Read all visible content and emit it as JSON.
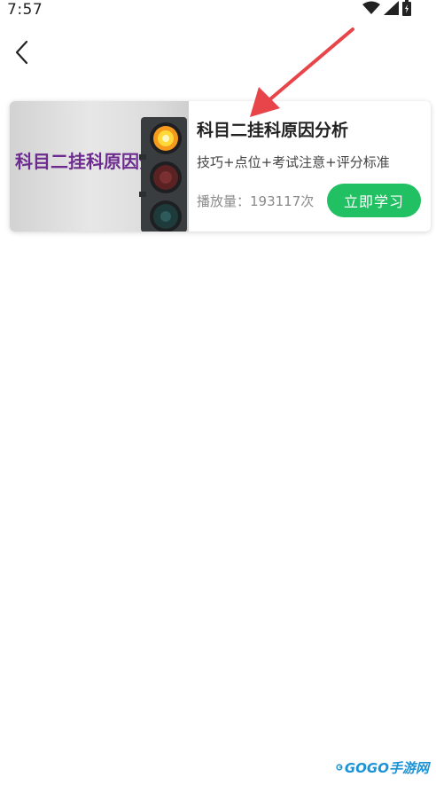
{
  "status_bar": {
    "time": "7:57",
    "icons": [
      "wifi-icon",
      "signal-icon",
      "battery-charging-icon"
    ]
  },
  "nav": {
    "back_icon": "chevron-left-icon"
  },
  "course_card": {
    "thumbnail_text": "科目二挂科原因分析",
    "title": "科目二挂科原因分析",
    "subtitle": "技巧+点位+考试注意+评分标准",
    "play_count": "播放量：193117次",
    "study_button_label": "立即学习",
    "accent_color": "#21c063",
    "thumbnail_text_color": "#6d2b8f"
  },
  "annotation": {
    "arrow_color": "#e8454a"
  },
  "watermark": {
    "text": "GOGO手游网"
  }
}
